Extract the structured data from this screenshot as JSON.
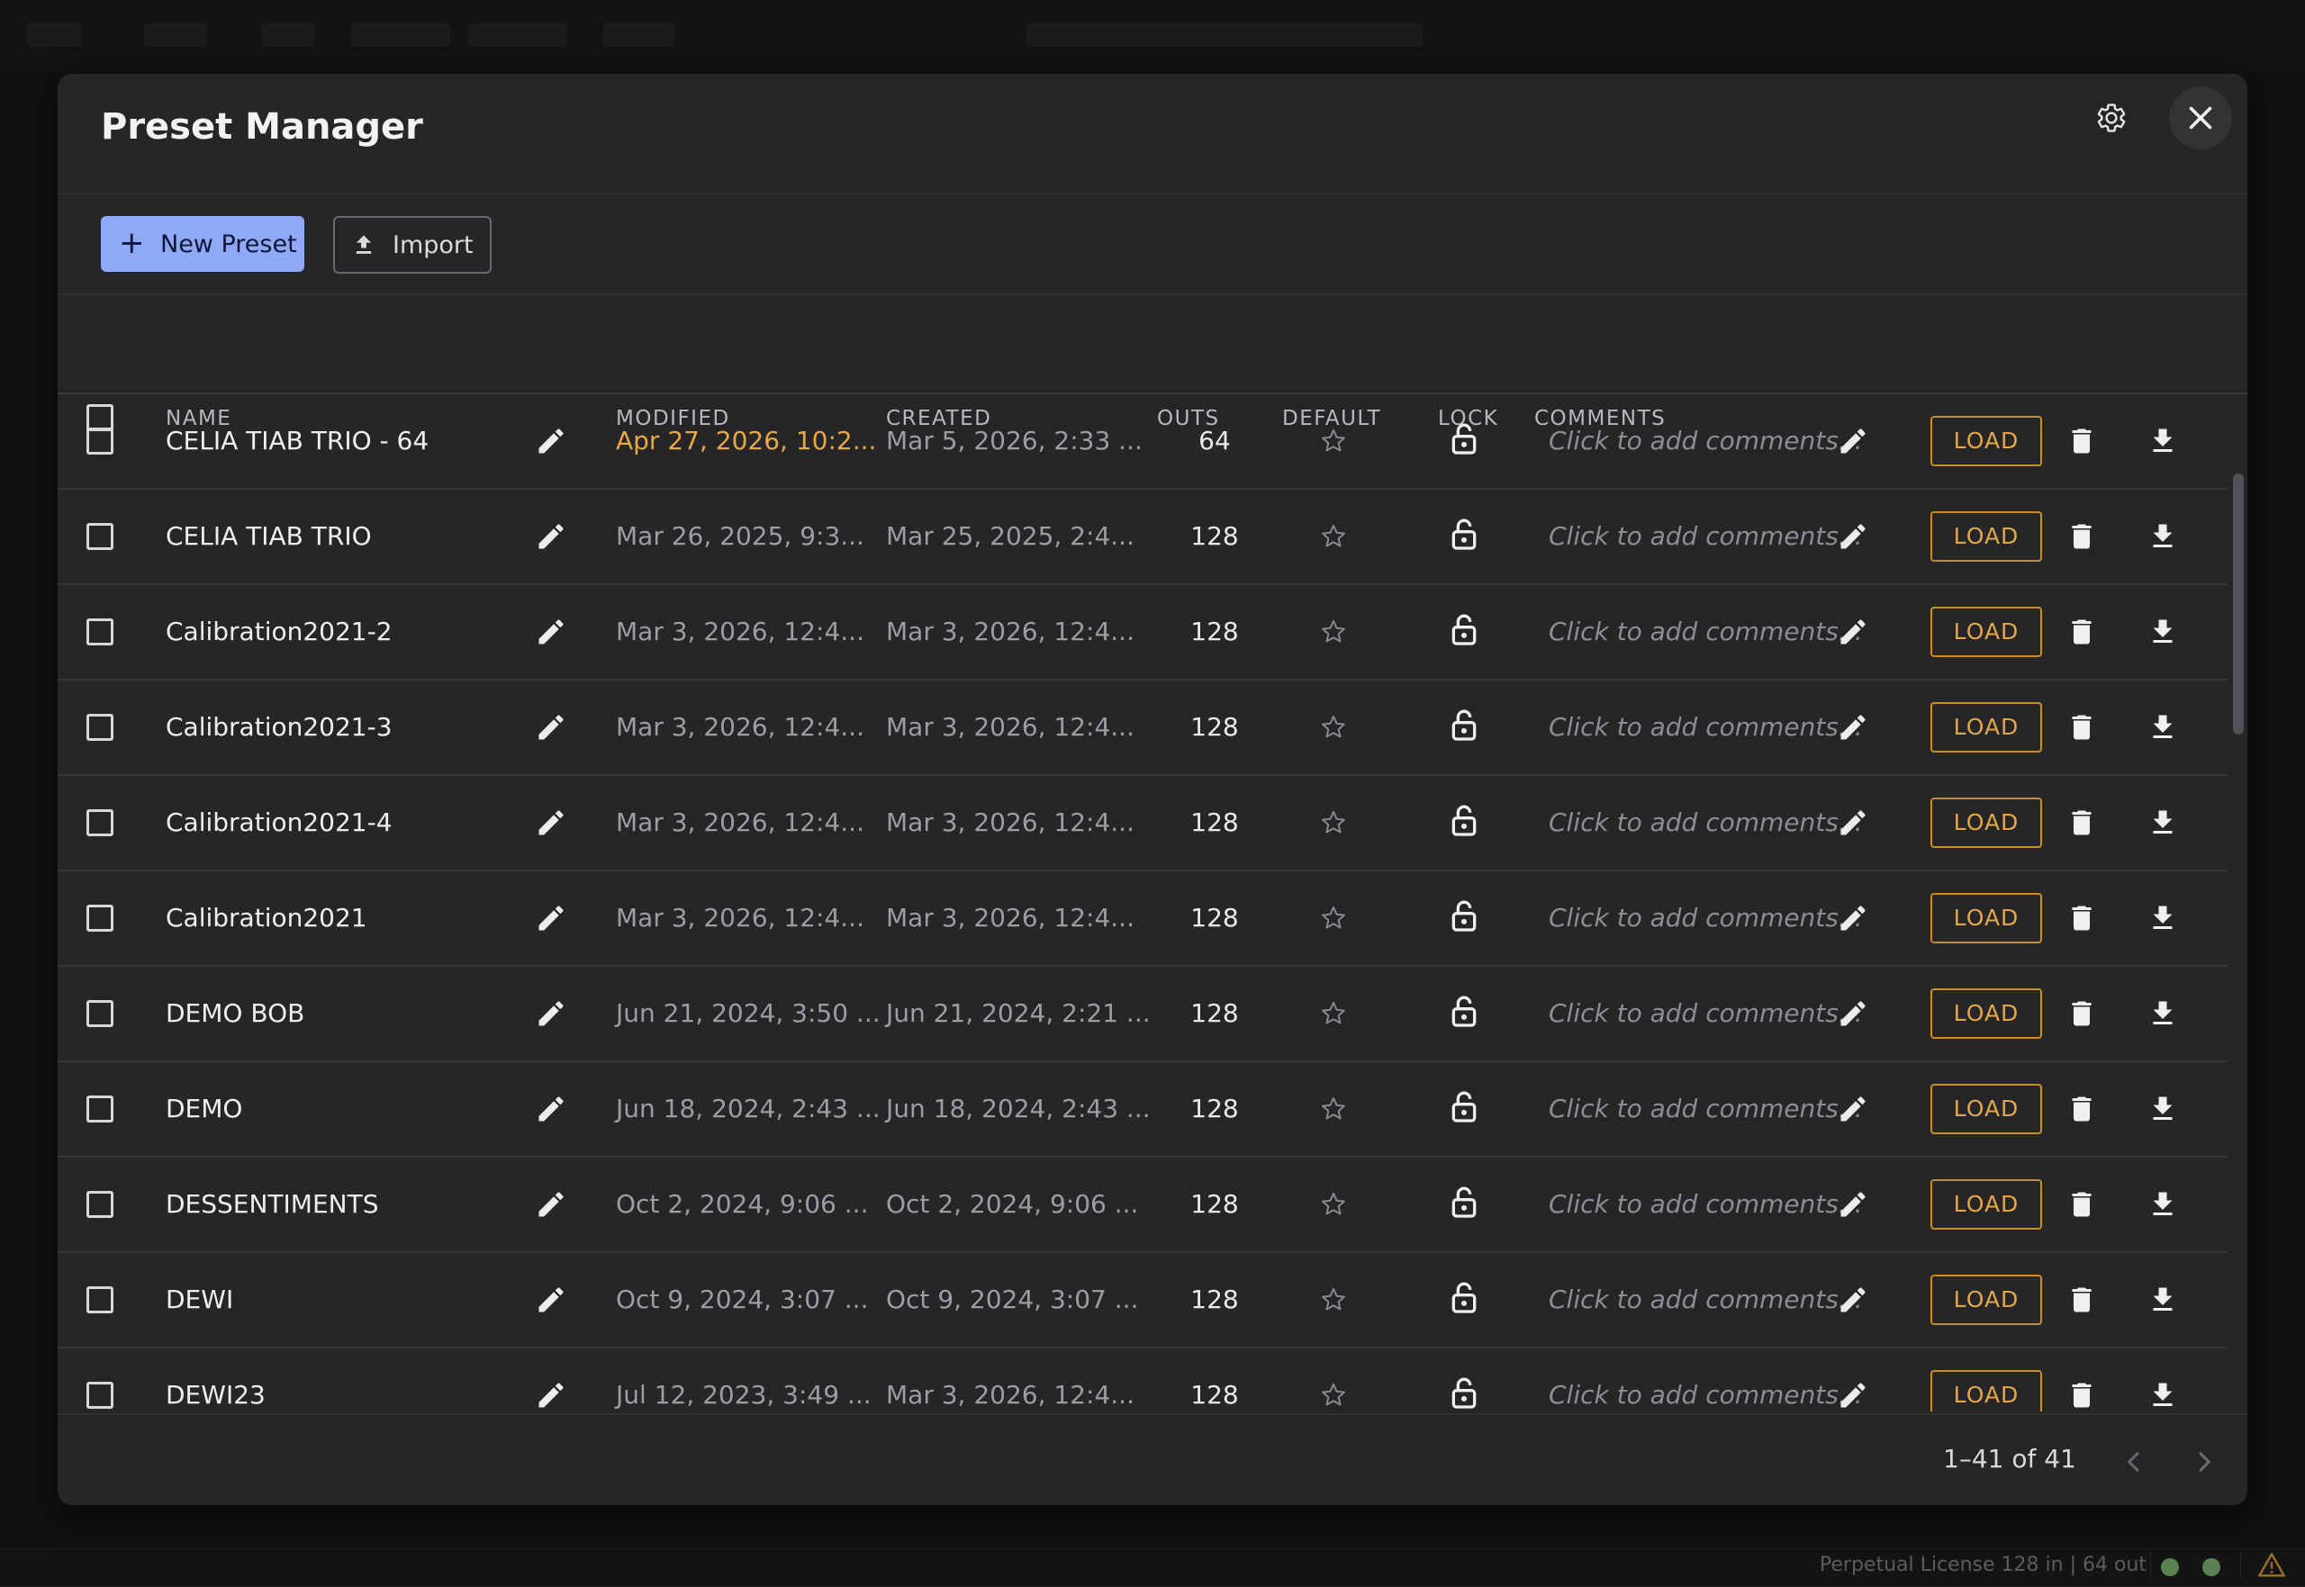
{
  "modal": {
    "title": "Preset Manager"
  },
  "toolbar": {
    "new_preset_label": "New Preset",
    "import_label": "Import"
  },
  "table": {
    "headers": {
      "name": "NAME",
      "modified": "MODIFIED",
      "created": "CREATED",
      "outs": "OUTS",
      "default": "DEFAULT",
      "lock": "LOCK",
      "comments": "COMMENTS"
    },
    "comment_placeholder": "Click to add comments...",
    "load_label": "LOAD",
    "rows": [
      {
        "name": "CELIA TIAB TRIO - 64",
        "modified": "Apr 27, 2026, 10:2...",
        "created": "Mar 5, 2026, 2:33 ...",
        "outs": "64",
        "modified_highlight": true
      },
      {
        "name": "CELIA TIAB TRIO",
        "modified": "Mar 26, 2025, 9:3...",
        "created": "Mar 25, 2025, 2:4...",
        "outs": "128"
      },
      {
        "name": "Calibration2021-2",
        "modified": "Mar 3, 2026, 12:4...",
        "created": "Mar 3, 2026, 12:4...",
        "outs": "128"
      },
      {
        "name": "Calibration2021-3",
        "modified": "Mar 3, 2026, 12:4...",
        "created": "Mar 3, 2026, 12:4...",
        "outs": "128"
      },
      {
        "name": "Calibration2021-4",
        "modified": "Mar 3, 2026, 12:4...",
        "created": "Mar 3, 2026, 12:4...",
        "outs": "128"
      },
      {
        "name": "Calibration2021",
        "modified": "Mar 3, 2026, 12:4...",
        "created": "Mar 3, 2026, 12:4...",
        "outs": "128"
      },
      {
        "name": "DEMO BOB",
        "modified": "Jun 21, 2024, 3:50 ...",
        "created": "Jun 21, 2024, 2:21 ...",
        "outs": "128"
      },
      {
        "name": "DEMO",
        "modified": "Jun 18, 2024, 2:43 ...",
        "created": "Jun 18, 2024, 2:43 ...",
        "outs": "128"
      },
      {
        "name": "DESSENTIMENTS",
        "modified": "Oct 2, 2024, 9:06 ...",
        "created": "Oct 2, 2024, 9:06 ...",
        "outs": "128"
      },
      {
        "name": "DEWI",
        "modified": "Oct 9, 2024, 3:07 ...",
        "created": "Oct 9, 2024, 3:07 ...",
        "outs": "128"
      },
      {
        "name": "DEWI23",
        "modified": "Jul 12, 2023, 3:49 ...",
        "created": "Mar 3, 2026, 12:4...",
        "outs": "128"
      }
    ]
  },
  "pagination": {
    "range_text": "1–41 of 41"
  },
  "statusbar": {
    "license_text": "Perpetual License 128 in | 64 out"
  },
  "colors": {
    "accent": "#8fa9f7",
    "load_outline": "#c98f2c",
    "highlight_date": "#e7a84a",
    "status_ok": "#8bc67b",
    "warning": "#e5a93a"
  }
}
